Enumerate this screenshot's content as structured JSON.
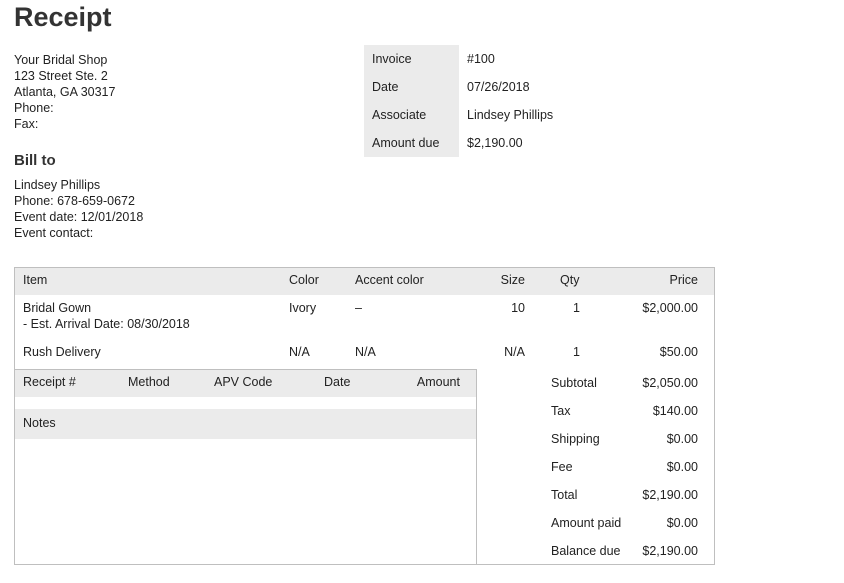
{
  "title": "Receipt",
  "shop": {
    "name": "Your Bridal Shop",
    "address1": "123 Street Ste. 2",
    "address2": "Atlanta, GA 30317",
    "phone": "Phone:",
    "fax": "Fax:"
  },
  "meta": [
    {
      "label": "Invoice",
      "value": "#100"
    },
    {
      "label": "Date",
      "value": "07/26/2018"
    },
    {
      "label": "Associate",
      "value": "Lindsey Phillips"
    },
    {
      "label": "Amount due",
      "value": "$2,190.00"
    }
  ],
  "bill_to": {
    "heading": "Bill to",
    "name": "Lindsey Phillips",
    "phone": "Phone: 678-659-0672",
    "event_date": "Event date: 12/01/2018",
    "event_contact": "Event contact:"
  },
  "items": {
    "headers": {
      "item": "Item",
      "color": "Color",
      "accent": "Accent color",
      "size": "Size",
      "qty": "Qty",
      "price": "Price"
    },
    "rows": [
      {
        "item": "Bridal Gown",
        "note": "- Est. Arrival Date: 08/30/2018",
        "color": "Ivory",
        "accent": "–",
        "size": "10",
        "qty": "1",
        "price": "$2,000.00"
      },
      {
        "item": "Rush Delivery",
        "note": "",
        "color": "N/A",
        "accent": "N/A",
        "size": "N/A",
        "qty": "1",
        "price": "$50.00"
      }
    ]
  },
  "payments": {
    "headers": {
      "receipt": "Receipt #",
      "method": "Method",
      "apv": "APV Code",
      "date": "Date",
      "amount": "Amount"
    },
    "notes_label": "Notes"
  },
  "totals": [
    {
      "label": "Subtotal",
      "value": "$2,050.00"
    },
    {
      "label": "Tax",
      "value": "$140.00"
    },
    {
      "label": "Shipping",
      "value": "$0.00"
    },
    {
      "label": "Fee",
      "value": "$0.00"
    },
    {
      "label": "Total",
      "value": "$2,190.00"
    },
    {
      "label": "Amount paid",
      "value": "$0.00"
    },
    {
      "label": "Balance due",
      "value": "$2,190.00"
    }
  ]
}
